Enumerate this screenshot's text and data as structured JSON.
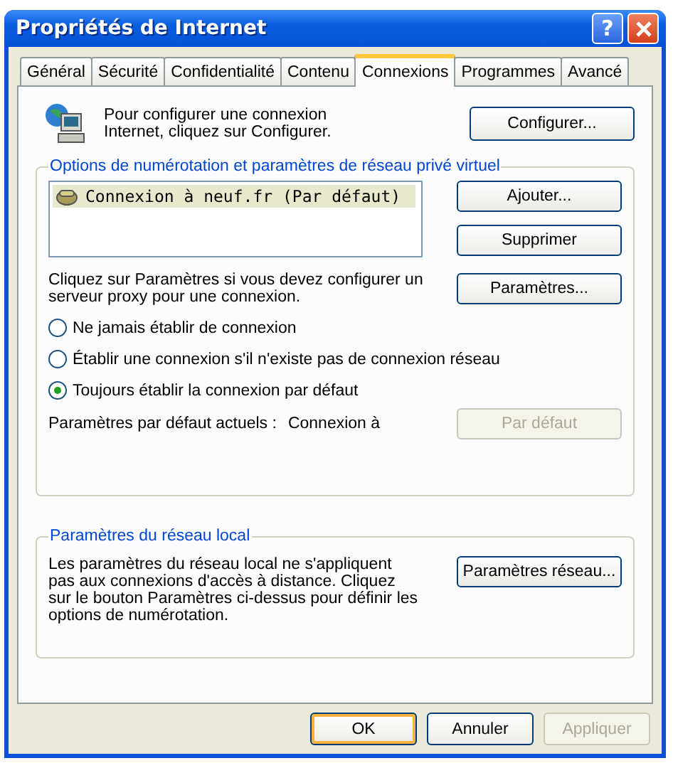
{
  "window": {
    "title": "Propriétés de Internet",
    "help_glyph": "?"
  },
  "tabs": [
    {
      "label": "Général",
      "selected": false
    },
    {
      "label": "Sécurité",
      "selected": false
    },
    {
      "label": "Confidentialité",
      "selected": false
    },
    {
      "label": "Contenu",
      "selected": false
    },
    {
      "label": "Connexions",
      "selected": true
    },
    {
      "label": "Programmes",
      "selected": false
    },
    {
      "label": "Avancé",
      "selected": false
    }
  ],
  "setup": {
    "text": "Pour configurer une connexion Internet, cliquez sur Configurer.",
    "button": "Configurer..."
  },
  "dialup": {
    "title": "Options de numérotation et paramètres de réseau privé virtuel",
    "connections": [
      {
        "label": "Connexion à neuf.fr (Par défaut)",
        "selected": true
      }
    ],
    "buttons": [
      {
        "label": "Ajouter...",
        "disabled": false
      },
      {
        "label": "Supprimer",
        "disabled": false
      }
    ],
    "proxy_text": "Cliquez sur Paramètres si vous devez configurer un serveur proxy pour une connexion.",
    "proxy_button": "Paramètres...",
    "options": [
      {
        "label": "Ne jamais établir de connexion",
        "selected": false
      },
      {
        "label": "Établir une connexion s'il n'existe pas de connexion réseau",
        "selected": false
      },
      {
        "label": "Toujours établir la connexion par défaut",
        "selected": true
      }
    ],
    "default_label": "Paramètres par défaut actuels :",
    "default_value": "Connexion à",
    "default_button": {
      "label": "Par défaut",
      "disabled": true
    }
  },
  "lan": {
    "title": "Paramètres du réseau local",
    "text": "Les paramètres du réseau local ne s'appliquent pas aux connexions d'accès à distance. Cliquez sur le bouton Paramètres ci-dessus pour définir les options de numérotation.",
    "button": "Paramètres réseau..."
  },
  "dialog_buttons": [
    {
      "label": "OK",
      "default": true,
      "disabled": false
    },
    {
      "label": "Annuler",
      "default": false,
      "disabled": false
    },
    {
      "label": "Appliquer",
      "default": false,
      "disabled": true
    }
  ]
}
